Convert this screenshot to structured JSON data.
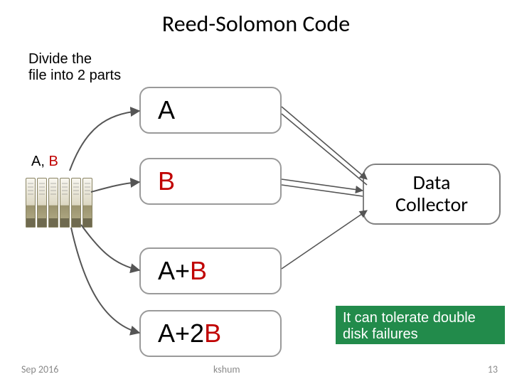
{
  "title": "Reed-Solomon Code",
  "subtitle": "Divide the\nfile into 2 parts",
  "label_a": "A",
  "label_sep": ", ",
  "label_b": "B",
  "nodes": {
    "a": "A",
    "b": "B",
    "apb_a": "A",
    "apb_plus": "+",
    "apb_b": "B",
    "ap2b_a": "A",
    "ap2b_plus2": "+2",
    "ap2b_b": "B"
  },
  "collector": "Data\nCollector",
  "callout": "It can tolerate double disk failures",
  "footer": {
    "date": "Sep 2016",
    "center": "kshum",
    "page": "13"
  },
  "chart_data": {
    "type": "table",
    "title": "Reed-Solomon Code — diagram layout",
    "source_label": "A, B",
    "encoded_blocks": [
      "A",
      "B",
      "A+B",
      "A+2B"
    ],
    "sink": "Data Collector",
    "note": "It can tolerate double disk failures",
    "edges": [
      {
        "from": "server",
        "to": "A"
      },
      {
        "from": "server",
        "to": "B"
      },
      {
        "from": "server",
        "to": "A+B"
      },
      {
        "from": "server",
        "to": "A+2B"
      },
      {
        "from": "A",
        "to": "Data Collector"
      },
      {
        "from": "B",
        "to": "Data Collector"
      },
      {
        "from": "A+B",
        "to": "Data Collector"
      }
    ]
  }
}
